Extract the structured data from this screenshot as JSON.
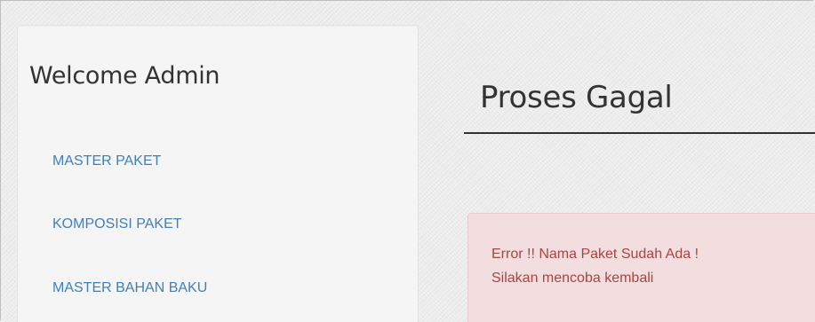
{
  "sidebar": {
    "heading": "Welcome Admin",
    "items": [
      {
        "label": "MASTER PAKET"
      },
      {
        "label": "KOMPOSISI PAKET"
      },
      {
        "label": "MASTER BAHAN BAKU"
      }
    ]
  },
  "main": {
    "title": "Proses Gagal",
    "alert": {
      "line1": "Error !! Nama Paket Sudah Ada !",
      "line2": "Silakan mencoba kembali"
    }
  },
  "colors": {
    "link": "#3f80b8",
    "alert_bg": "#f2dede",
    "alert_text": "#a94442",
    "heading_text": "#333333"
  }
}
